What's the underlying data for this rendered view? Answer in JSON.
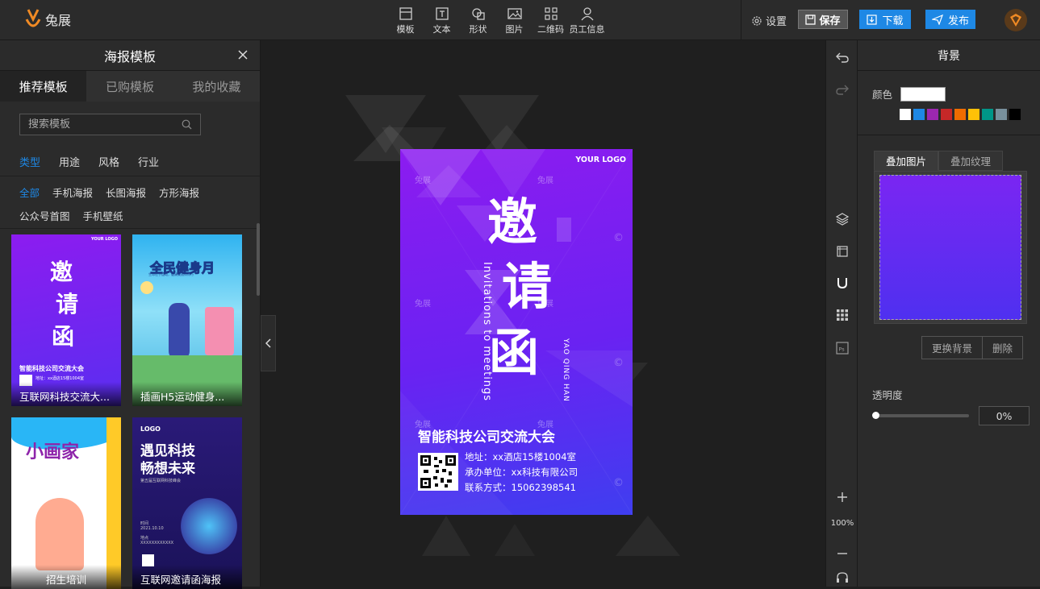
{
  "app": {
    "logo_text": "兔展"
  },
  "toolbar": {
    "tools": [
      {
        "label": "模板",
        "icon": "template-icon"
      },
      {
        "label": "文本",
        "icon": "text-icon"
      },
      {
        "label": "形状",
        "icon": "shape-icon"
      },
      {
        "label": "图片",
        "icon": "image-icon"
      },
      {
        "label": "二维码",
        "icon": "qrcode-icon"
      },
      {
        "label": "员工信息",
        "icon": "user-icon"
      }
    ],
    "settings_label": "设置",
    "save_label": "保存",
    "download_label": "下载",
    "publish_label": "发布"
  },
  "left_panel": {
    "title": "海报模板",
    "tabs": [
      "推荐模板",
      "已购模板",
      "我的收藏"
    ],
    "active_tab": 0,
    "search": {
      "placeholder": "搜索模板"
    },
    "categories": [
      "类型",
      "用途",
      "风格",
      "行业"
    ],
    "active_category": 0,
    "sub_tags": [
      "全部",
      "手机海报",
      "长图海报",
      "方形海报",
      "公众号首图",
      "手机壁纸"
    ],
    "active_sub_tag": 0,
    "cards": [
      {
        "title": "互联网科技交流大...",
        "bg": "#6a22f2"
      },
      {
        "title": "插画H5运动健身...",
        "bg": "#36b8f0"
      },
      {
        "title": "招生培训",
        "bg": "#ffffff"
      },
      {
        "title": "互联网邀请函海报",
        "bg": "#2a1a78"
      }
    ],
    "card_texts": {
      "c1_logo": "YOUR LOGO",
      "c1_chars": [
        "邀",
        "请",
        "函"
      ],
      "c1_conf": "智能科技公司交流大会",
      "c1_addr": "地址：xx酒店15楼1004室",
      "c2_title": "全民健身月",
      "c2_sub": "生命在于运动，健康美丽伴你行",
      "c3_title": "小画家",
      "c4_logo": "LOGO",
      "c4_title1": "遇见科技",
      "c4_title2": "畅想未来",
      "c4_sub": "第五届互联网科技峰会",
      "c4_time_label": "时间",
      "c4_time": "2021.10.10",
      "c4_place_label": "地点",
      "c4_place": "XXXXXXXXXXXX"
    }
  },
  "poster": {
    "logo": "YOUR LOGO",
    "chars": [
      "邀",
      "请",
      "函"
    ],
    "invite_en": "Invitations to meetings",
    "yao_pinyin": "YAO QING HAN",
    "conference": "智能科技公司交流大会",
    "address": "地址：xx酒店15楼1004室",
    "organizer": "承办单位：xx科技有限公司",
    "contact": "联系方式：15062398541",
    "watermark": "兔展",
    "copyright_mark": "©"
  },
  "tool_strip": {
    "zoom": "100%"
  },
  "right_panel": {
    "title": "背景",
    "color_label": "颜色",
    "current_color": "#ffffff",
    "swatches": [
      "#ffffff",
      "#1e88e5",
      "#9c27b0",
      "#c62828",
      "#ef6c00",
      "#ffc107",
      "#009688",
      "#78909c",
      "#000000"
    ],
    "overlay_tabs": [
      "叠加图片",
      "叠加纹理"
    ],
    "active_overlay_tab": 0,
    "replace_bg_label": "更换背景",
    "delete_label": "删除",
    "opacity_label": "透明度",
    "opacity_value": "0%",
    "opacity_fraction": 0
  }
}
